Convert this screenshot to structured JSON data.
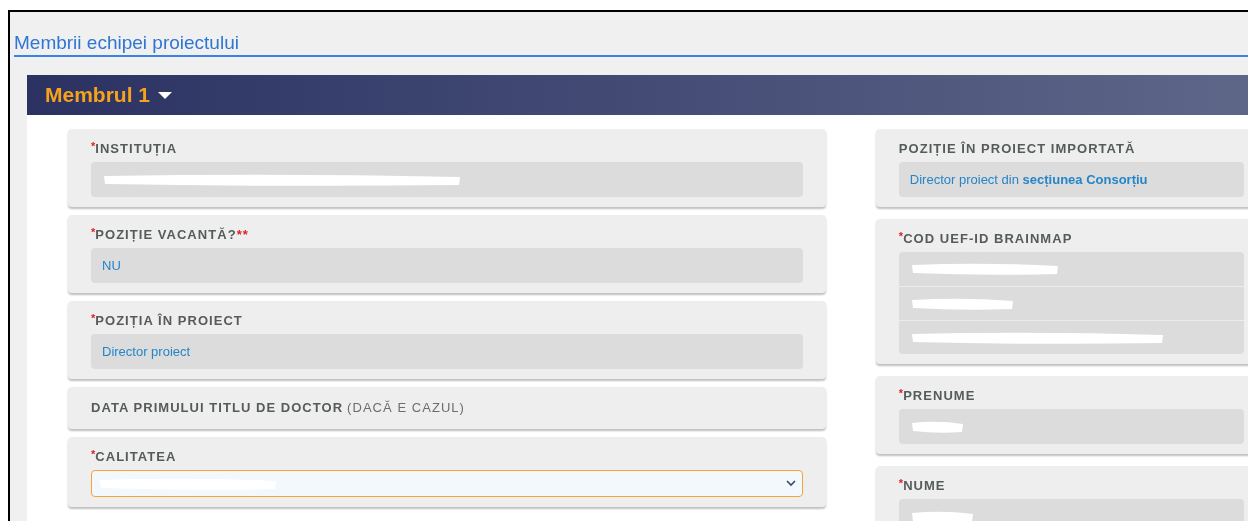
{
  "section": {
    "title": "Membrii echipei proiectului"
  },
  "member": {
    "title": "Membrul 1",
    "expanded": true
  },
  "columns": [
    {
      "fields": [
        {
          "kind": "text",
          "required_mark": "*",
          "label": "INSTITUȚIA",
          "entries": [
            {
              "redacted": true
            }
          ]
        },
        {
          "kind": "text",
          "required_mark": "*",
          "label": "POZIȚIE VACANTĂ?",
          "label_suffix": "**",
          "entries": [
            {
              "redacted": false,
              "text": "NU"
            }
          ]
        },
        {
          "kind": "text",
          "required_mark": "*",
          "label": "POZIȚIA ÎN PROIECT",
          "entries": [
            {
              "redacted": false,
              "text": "Director proiect"
            }
          ]
        },
        {
          "kind": "heading",
          "label": "DATA PRIMULUI TITLU DE DOCTOR",
          "label_note": "(DACĂ E CAZUL)"
        },
        {
          "kind": "select",
          "required_mark": "*",
          "label": "CALITATEA",
          "focused": true,
          "entries": [
            {
              "redacted": true
            }
          ]
        }
      ]
    },
    {
      "fields": [
        {
          "kind": "text",
          "label": "POZIȚIE ÎN PROIECT IMPORTATĂ",
          "entries": [
            {
              "redacted": false,
              "text": "Director proiect din **secțiunea Consorțiu**"
            }
          ]
        },
        {
          "kind": "text",
          "required_mark": "*",
          "label": "COD UEF-ID BRAINMAP",
          "entries": [
            {
              "redacted": true
            },
            {
              "redacted": true
            },
            {
              "redacted": true
            }
          ]
        },
        {
          "kind": "text",
          "required_mark": "*",
          "label": "PRENUME",
          "entries": [
            {
              "redacted": true
            }
          ]
        },
        {
          "kind": "text",
          "required_mark": "*",
          "label": "NUME",
          "entries": [
            {
              "redacted": true
            }
          ]
        }
      ]
    }
  ]
}
